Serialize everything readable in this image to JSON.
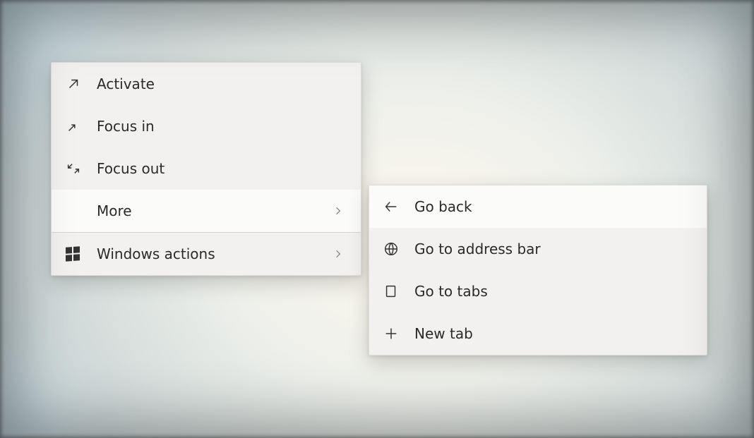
{
  "main_menu": {
    "activate": "Activate",
    "focus_in": "Focus in",
    "focus_out": "Focus out",
    "more": "More",
    "windows_actions": "Windows actions"
  },
  "sub_menu": {
    "go_back": "Go back",
    "go_to_address_bar": "Go to address bar",
    "go_to_tabs": "Go to tabs",
    "new_tab": "New tab"
  }
}
